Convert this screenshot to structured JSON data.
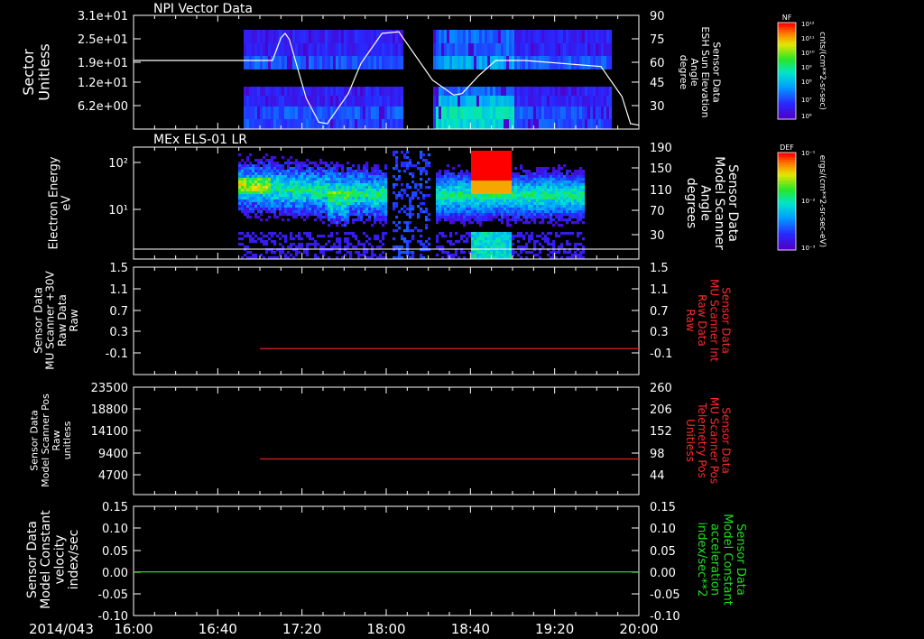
{
  "chart_data": [
    {
      "type": "heatmap",
      "title": "NPI Vector Data",
      "ylabel": [
        "Sector",
        "Unitless"
      ],
      "y_tick_labels": [
        "3.1e+01",
        "2.5e+01",
        "1.9e+01",
        "1.2e+01",
        "6.2e+00"
      ],
      "y2label": [
        "Sensor Data",
        "ESH Sun Elevation",
        "Angle",
        "degree"
      ],
      "y2_tick_labels": [
        "90",
        "75",
        "60",
        "45",
        "30"
      ],
      "y2lim": [
        15,
        90
      ],
      "colorbar": {
        "label": "NF",
        "unit": "cnts/(cm**2-sr-sec)",
        "tick_labels": [
          "10¹²",
          "10¹¹",
          "10¹⁰",
          "10⁹",
          "10⁸",
          "10⁷",
          "10⁶"
        ]
      },
      "overlay_line": {
        "color": "#ffffff",
        "x_minutes": [
          0,
          55,
          62,
          66,
          70,
          72,
          74,
          82,
          88,
          92,
          102,
          108,
          118,
          126,
          142,
          152,
          156,
          164,
          172,
          186,
          222,
          232,
          236,
          240
        ],
        "values": [
          60,
          60,
          60,
          60,
          75,
          78,
          74,
          35,
          19,
          18,
          38,
          58,
          78,
          79,
          47,
          37,
          38,
          50,
          60,
          60,
          56,
          36,
          18,
          17
        ]
      }
    },
    {
      "type": "heatmap",
      "title": "MEx ELS-01 LR",
      "ylabel": [
        "Electron Energy",
        "eV"
      ],
      "y_tick_labels": [
        "10²",
        "10¹"
      ],
      "y2label": [
        "Sensor Data",
        "Model Scanner",
        "Angle",
        "degrees"
      ],
      "y2_tick_labels": [
        "190",
        "150",
        "110",
        "70",
        "30"
      ],
      "y2lim": [
        0,
        190
      ],
      "colorbar": {
        "label": "DEF",
        "unit": "ergs/(cm**2-sr-sec-eV)",
        "tick_labels": [
          "10⁻¹",
          "10⁻²",
          "10⁻³"
        ]
      },
      "overlay_line": {
        "color": "#ffffff",
        "x_minutes": [
          0,
          240
        ],
        "values": [
          3,
          3
        ]
      }
    },
    {
      "type": "line",
      "ylabel": [
        "Sensor Data",
        "MU Scanner +30V",
        "Raw Data",
        "Raw"
      ],
      "y_tick_labels": [
        "1.5",
        "1.1",
        "0.7",
        "0.3",
        "-0.1"
      ],
      "ylim": [
        -0.5,
        1.5
      ],
      "y2label": [
        "Sensor Data",
        "MU Scanner Int",
        "Raw Data",
        "Raw"
      ],
      "y2_tick_labels": [
        "1.5",
        "1.1",
        "0.7",
        "0.3",
        "-0.1"
      ],
      "series": [
        {
          "color": "#dd2222",
          "x_minutes": [
            60,
            240
          ],
          "values": [
            -0.02,
            -0.02
          ]
        }
      ]
    },
    {
      "type": "line",
      "ylabel": [
        "Sensor Data",
        "Model Scanner Pos",
        "Raw",
        "unitless"
      ],
      "y_tick_labels": [
        "23500",
        "18800",
        "14100",
        "9400",
        "4700"
      ],
      "ylim": [
        0,
        23500
      ],
      "y2label": [
        "Sensor Data",
        "MU Scanner Pos",
        "Telemetry Pos",
        "Unitless"
      ],
      "y2_tick_labels": [
        "260",
        "206",
        "152",
        "98",
        "44"
      ],
      "series": [
        {
          "color": "#dd2222",
          "x_minutes": [
            60,
            240
          ],
          "values": [
            7800,
            7800
          ]
        }
      ]
    },
    {
      "type": "line",
      "ylabel": [
        "Sensor Data",
        "Model Constant",
        "velocity",
        "index/sec"
      ],
      "y_tick_labels": [
        "0.15",
        "0.10",
        "0.05",
        "0.00",
        "-0.05",
        "-0.10"
      ],
      "ylim": [
        -0.1,
        0.15
      ],
      "y2label": [
        "Sensor Data",
        "Model Constant",
        "acceleration",
        "index/sec**2"
      ],
      "y2_tick_labels": [
        "0.15",
        "0.10",
        "0.05",
        "0.00",
        "-0.05",
        "-0.10"
      ],
      "series": [
        {
          "color": "#22dd22",
          "x_minutes": [
            0,
            240
          ],
          "values": [
            0,
            0
          ]
        }
      ]
    }
  ],
  "x_axis": {
    "date_label": "2014/043",
    "tick_labels": [
      "16:00",
      "16:40",
      "17:20",
      "18:00",
      "18:40",
      "19:20",
      "20:00"
    ]
  }
}
